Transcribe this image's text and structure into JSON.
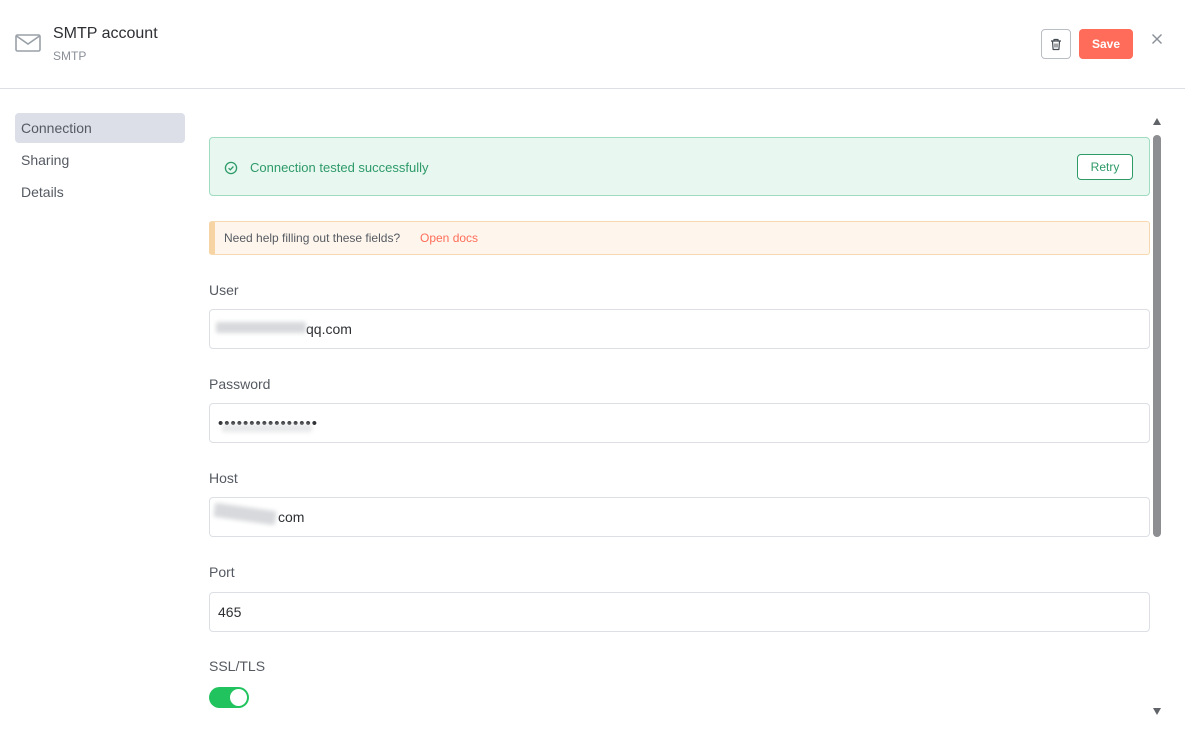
{
  "header": {
    "title": "SMTP account",
    "subtitle": "SMTP",
    "icon": "mail-icon",
    "save_label": "Save",
    "delete_icon": "trash-icon",
    "close_icon": "close-icon",
    "save_color": "#ff6d5a"
  },
  "sidebar": {
    "items": [
      {
        "label": "Connection",
        "active": true
      },
      {
        "label": "Sharing",
        "active": false
      },
      {
        "label": "Details",
        "active": false
      }
    ]
  },
  "banner": {
    "success_text": "Connection tested successfully",
    "retry_label": "Retry",
    "success_color": "#2e9a68",
    "help_text": "Need help filling out these fields?",
    "help_link": "Open docs"
  },
  "fields": {
    "user": {
      "label": "User",
      "value": "qq.com"
    },
    "password": {
      "label": "Password",
      "value": "••••••••••••••••"
    },
    "host": {
      "label": "Host",
      "value": "com"
    },
    "port": {
      "label": "Port",
      "value": "465"
    },
    "ssl": {
      "label": "SSL/TLS",
      "enabled": true,
      "color": "#21c35e"
    }
  }
}
